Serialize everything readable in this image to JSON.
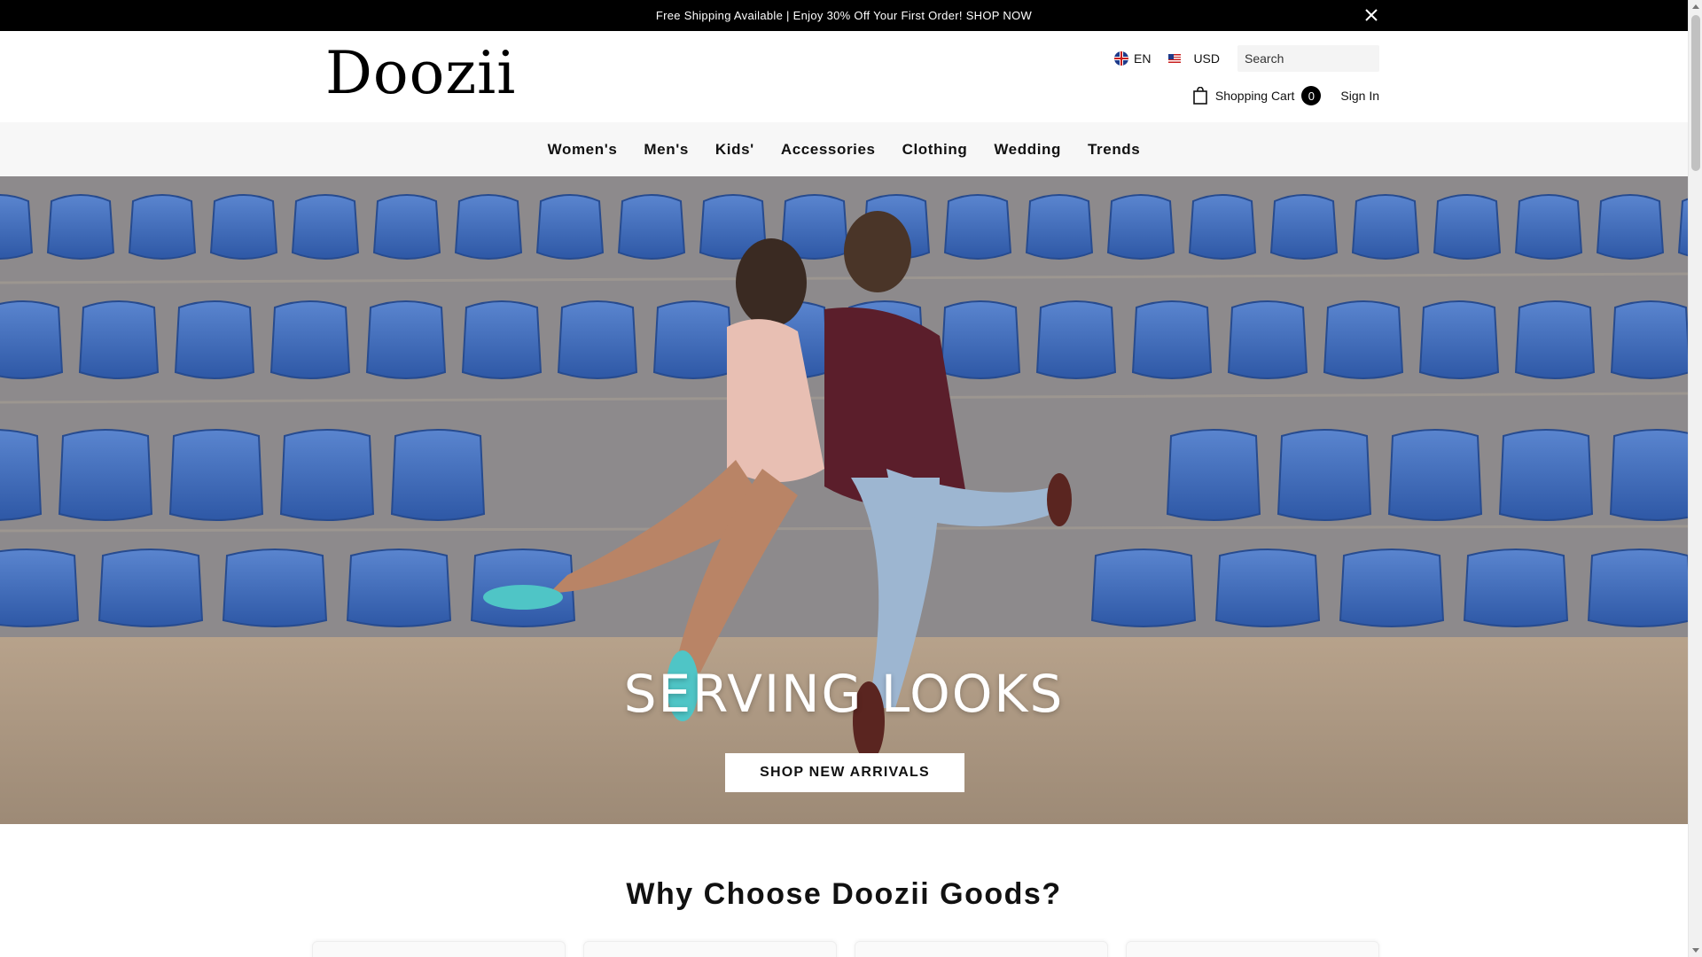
{
  "announcement": {
    "text": "Free Shipping Available | Enjoy 30% Off Your First Order! SHOP NOW",
    "close_icon": "close-icon"
  },
  "header": {
    "logo": "Doozii",
    "language": "EN",
    "currency": "USD",
    "search_placeholder": "Search",
    "cart_label": "Shopping Cart",
    "cart_count": "0",
    "sign_in": "Sign In"
  },
  "nav": {
    "items": [
      "Women's",
      "Men's",
      "Kids'",
      "Accessories",
      "Clothing",
      "Wedding",
      "Trends"
    ]
  },
  "hero": {
    "title": "SERVING LOOKS",
    "cta": "SHOP NEW ARRIVALS"
  },
  "why": {
    "title": "Why Choose Doozii Goods?"
  },
  "colors": {
    "announcement_bg": "#000000",
    "nav_bg": "#f7f7f7",
    "seat_blue": "#3d67b4",
    "accent": "#000000"
  }
}
